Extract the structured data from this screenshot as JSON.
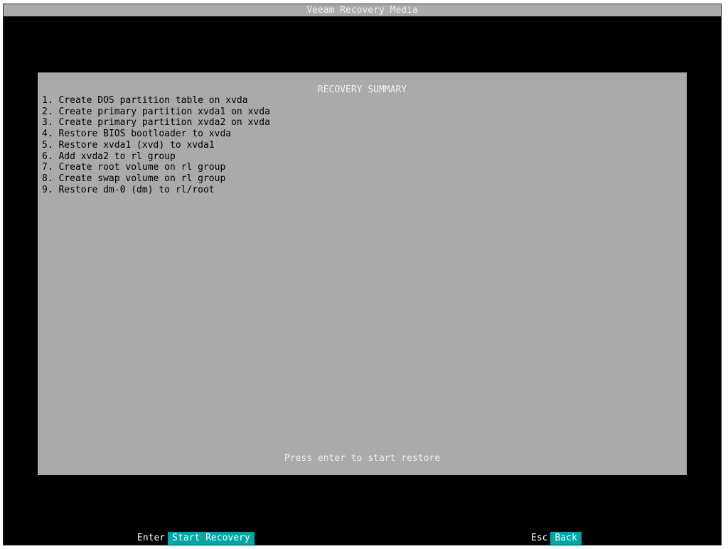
{
  "window": {
    "title": "Veeam Recovery Media"
  },
  "summary": {
    "title": "RECOVERY SUMMARY",
    "steps": [
      "1. Create DOS partition table on xvda",
      "2. Create primary partition xvda1 on xvda",
      "3. Create primary partition xvda2 on xvda",
      "4. Restore BIOS bootloader to xvda",
      "5. Restore xvda1 (xvd) to xvda1",
      "6. Add xvda2 to rl group",
      "7. Create root volume on rl group",
      "8. Create swap volume on rl group",
      "9. Restore dm-0 (dm) to rl/root"
    ],
    "hint": "Press enter to start restore"
  },
  "footer": {
    "enter_key": "Enter",
    "enter_action": "Start Recovery",
    "esc_key": "Esc",
    "esc_action": "Back"
  },
  "colors": {
    "title_bar": "#aaaaaa",
    "panel": "#aaaaaa",
    "background": "#000000",
    "accent": "#00a7a7"
  }
}
